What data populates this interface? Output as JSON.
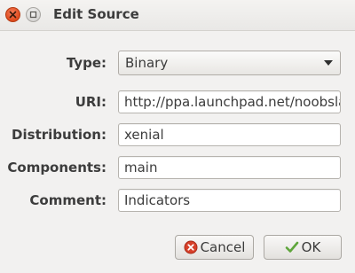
{
  "window": {
    "title": "Edit Source"
  },
  "form": {
    "type_label": "Type:",
    "type_value": "Binary",
    "uri_label": "URI:",
    "uri_value": "http://ppa.launchpad.net/noobslab/indicators/ubuntu",
    "distribution_label": "Distribution:",
    "distribution_value": "xenial",
    "components_label": "Components:",
    "components_value": "main",
    "comment_label": "Comment:",
    "comment_value": "Indicators"
  },
  "buttons": {
    "cancel_label": "Cancel",
    "ok_label": "OK"
  },
  "icons": {
    "close": "close-icon",
    "minimize": "minimize-icon",
    "dropdown": "chevron-down-icon",
    "cancel": "cancel-icon",
    "ok": "checkmark-icon"
  },
  "colors": {
    "close_button": "#df4a1c",
    "ok_check": "#5ea53b",
    "cancel_icon": "#d7402a",
    "background": "#f2f1f0"
  }
}
